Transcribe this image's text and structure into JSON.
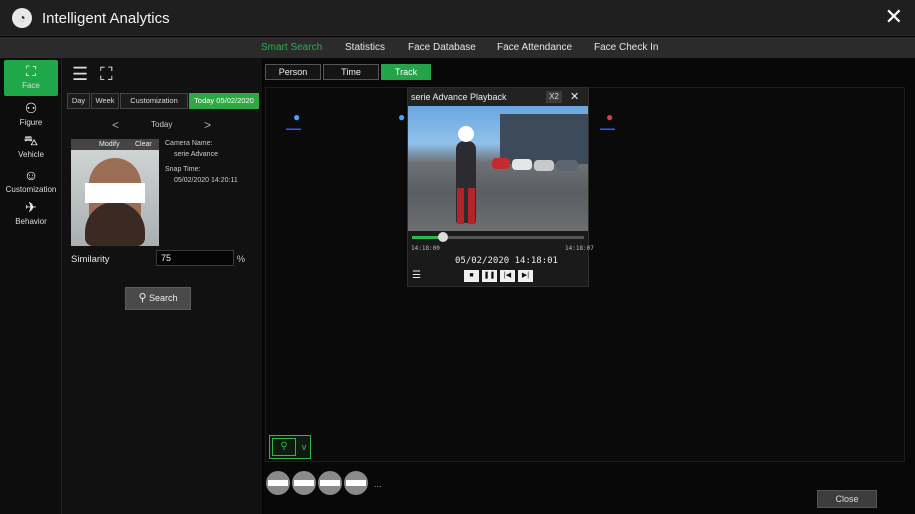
{
  "app": {
    "title": "Intelligent Analytics",
    "logo_icon": "analytics-logo-icon"
  },
  "menu": [
    {
      "label": "Smart Search",
      "active": true
    },
    {
      "label": "Statistics"
    },
    {
      "label": "Face Database"
    },
    {
      "label": "Face Attendance"
    },
    {
      "label": "Face Check In"
    }
  ],
  "sidebar": [
    {
      "label": "Face",
      "icon": "face-icon",
      "active": true
    },
    {
      "label": "Figure",
      "icon": "figure-icon"
    },
    {
      "label": "Vehicle",
      "icon": "vehicle-icon"
    },
    {
      "label": "Customization",
      "icon": "customization-icon"
    },
    {
      "label": "Behavior",
      "icon": "behavior-icon"
    }
  ],
  "filter": {
    "day": "Day",
    "week": "Week",
    "customization": "Customization",
    "today_date": "Today 05/02/2020",
    "prev": "<",
    "today": "Today",
    "next": ">",
    "modify": "Modify",
    "clear": "Clear",
    "camera_name_label": "Camera Name:",
    "camera_name": "serie Advance",
    "snap_time_label": "Snap Time:",
    "snap_time": "05/02/2020 14:20:11",
    "similarity_label": "Similarity",
    "similarity_value": "75",
    "similarity_unit": "%",
    "search_label": "Search"
  },
  "mode_tabs": [
    {
      "label": "Person"
    },
    {
      "label": "Time"
    },
    {
      "label": "Track",
      "active": true
    }
  ],
  "playback": {
    "title": "serie Advance Playback",
    "speed": "X2",
    "close": "✕",
    "start_time": "14:18:00",
    "end_time": "14:18:07",
    "current_time": "05/02/2020 14:18:01",
    "progress": 0.18
  },
  "bottom": {
    "more": "...",
    "close_label": "Close"
  },
  "colors": {
    "accent": "#28b24b",
    "pin_blue": "#4aa0ff",
    "pin_red": "#e0393e"
  }
}
